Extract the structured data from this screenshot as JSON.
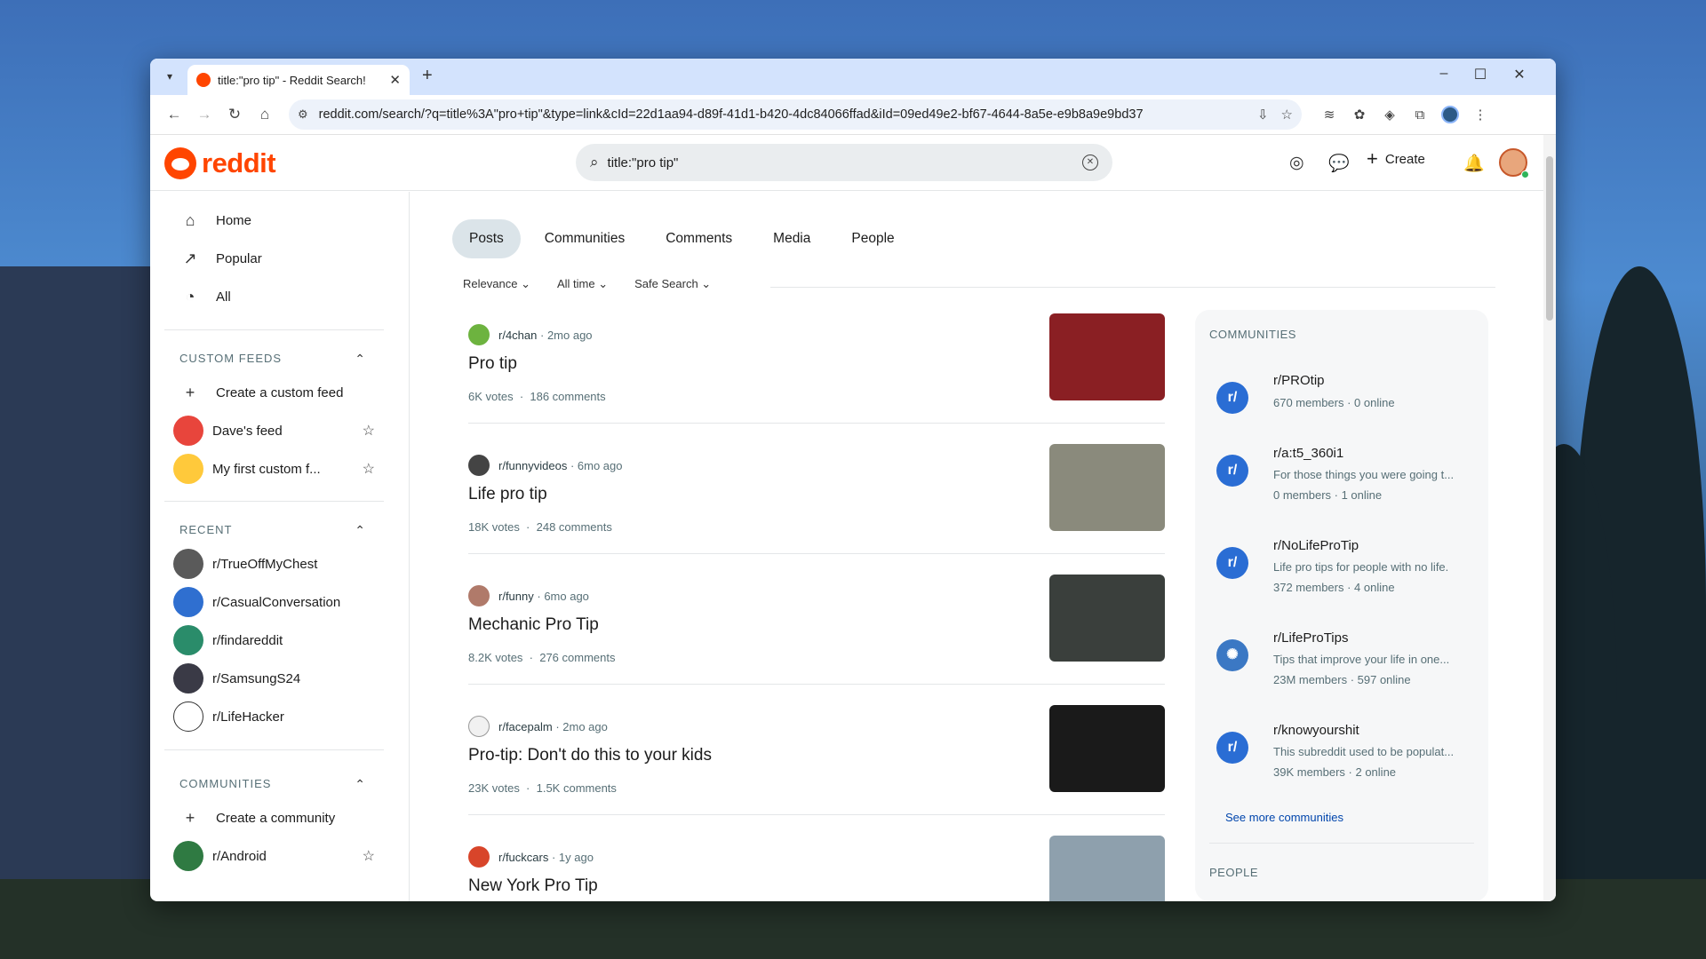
{
  "browser": {
    "tab_title": "title:\"pro tip\" - Reddit Search!",
    "url": "reddit.com/search/?q=title%3A\"pro+tip\"&type=link&cId=22d1aa94-d89f-41d1-b420-4dc84066ffad&iId=09ed49e2-bf67-4644-8a5e-e9b8a9e9bd37"
  },
  "header": {
    "logo_text": "reddit",
    "search_value": "title:\"pro tip\"",
    "create_label": "Create"
  },
  "sidebar": {
    "nav": [
      {
        "label": "Home",
        "icon": "home-icon"
      },
      {
        "label": "Popular",
        "icon": "popular-icon"
      },
      {
        "label": "All",
        "icon": "all-icon"
      }
    ],
    "custom_feeds_heading": "CUSTOM FEEDS",
    "custom_feeds": [
      {
        "label": "Create a custom feed"
      },
      {
        "label": "Dave's feed",
        "color": "#e8453c"
      },
      {
        "label": "My first custom f...",
        "color": "#ffc93b"
      }
    ],
    "recent_heading": "RECENT",
    "recent": [
      {
        "label": "r/TrueOffMyChest",
        "color": "#5a5a5a"
      },
      {
        "label": "r/CasualConversation",
        "color": "#2f6fd0"
      },
      {
        "label": "r/findareddit",
        "color": "#2a8c6a"
      },
      {
        "label": "r/SamsungS24",
        "color": "#3a3a46"
      },
      {
        "label": "r/LifeHacker",
        "color": "#ffffff"
      }
    ],
    "communities_heading": "COMMUNITIES",
    "communities": [
      {
        "label": "Create a community"
      },
      {
        "label": "r/Android",
        "color": "#2f7a42"
      }
    ]
  },
  "tabs": [
    "Posts",
    "Communities",
    "Comments",
    "Media",
    "People"
  ],
  "filters": [
    "Relevance",
    "All time",
    "Safe Search"
  ],
  "posts": [
    {
      "sub": "r/4chan",
      "age": "2mo ago",
      "title": "Pro tip",
      "votes": "6K votes",
      "comments": "186 comments",
      "icon_color": "#6db33f",
      "thumb_color": "#8a1f23"
    },
    {
      "sub": "r/funnyvideos",
      "age": "6mo ago",
      "title": "Life pro tip",
      "votes": "18K votes",
      "comments": "248 comments",
      "icon_color": "#444444",
      "thumb_color": "#8a8a7c"
    },
    {
      "sub": "r/funny",
      "age": "6mo ago",
      "title": "Mechanic Pro Tip",
      "votes": "8.2K votes",
      "comments": "276 comments",
      "icon_color": "#b07a6a",
      "thumb_color": "#3a3f3c"
    },
    {
      "sub": "r/facepalm",
      "age": "2mo ago",
      "title": "Pro-tip: Don't do this to your kids",
      "votes": "23K votes",
      "comments": "1.5K comments",
      "icon_color": "#f1f1f1",
      "thumb_color": "#1a1a1a"
    },
    {
      "sub": "r/fuckcars",
      "age": "1y ago",
      "title": "New York Pro Tip",
      "votes": "",
      "comments": "",
      "icon_color": "#d8452a",
      "thumb_color": "#8ea0ad"
    }
  ],
  "right_panel": {
    "communities_heading": "COMMUNITIES",
    "communities": [
      {
        "name": "r/PROtip",
        "desc": "",
        "members": "670 members",
        "online": "0 online"
      },
      {
        "name": "r/a:t5_360i1",
        "desc": "For those things you were going t...",
        "members": "0 members",
        "online": "1 online"
      },
      {
        "name": "r/NoLifeProTip",
        "desc": "Life pro tips for people with no life.",
        "members": "372 members",
        "online": "4 online"
      },
      {
        "name": "r/LifeProTips",
        "desc": "Tips that improve your life in one...",
        "members": "23M members",
        "online": "597 online"
      },
      {
        "name": "r/knowyourshit",
        "desc": "This subreddit used to be populat...",
        "members": "39K members",
        "online": "2 online"
      }
    ],
    "see_more": "See more communities",
    "people_heading": "PEOPLE"
  },
  "colors": {
    "accent": "#ff4500",
    "link": "#0045ac",
    "active_tab": "#dbe4e9"
  }
}
